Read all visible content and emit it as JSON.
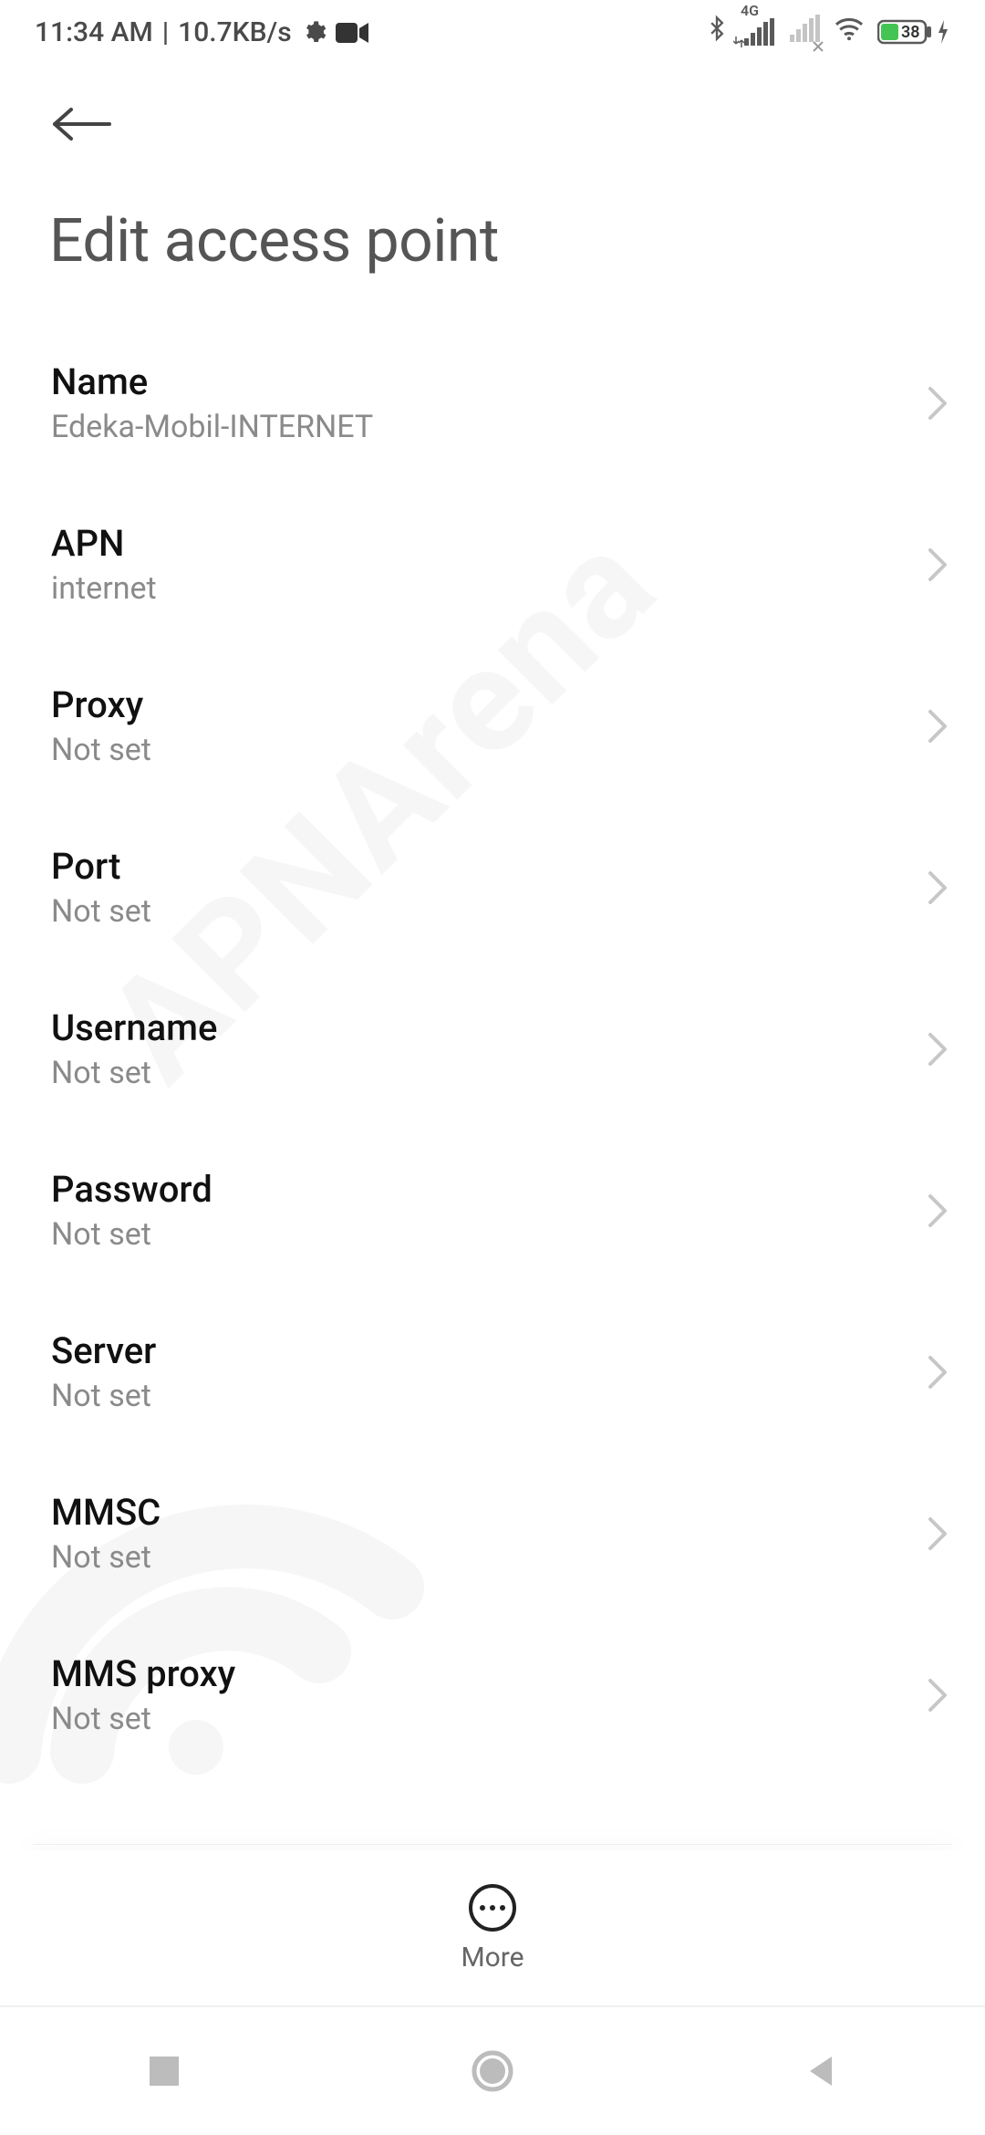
{
  "status": {
    "time": "11:34 AM",
    "separator": "|",
    "speed": "10.7KB/s",
    "network_label_4g": "4G",
    "battery_pct": "38"
  },
  "header": {
    "title": "Edit access point"
  },
  "fields": [
    {
      "label": "Name",
      "value": "Edeka-Mobil-INTERNET"
    },
    {
      "label": "APN",
      "value": "internet"
    },
    {
      "label": "Proxy",
      "value": "Not set"
    },
    {
      "label": "Port",
      "value": "Not set"
    },
    {
      "label": "Username",
      "value": "Not set"
    },
    {
      "label": "Password",
      "value": "Not set"
    },
    {
      "label": "Server",
      "value": "Not set"
    },
    {
      "label": "MMSC",
      "value": "Not set"
    },
    {
      "label": "MMS proxy",
      "value": "Not set"
    }
  ],
  "bottom": {
    "more_label": "More"
  },
  "watermark": "APNArena"
}
